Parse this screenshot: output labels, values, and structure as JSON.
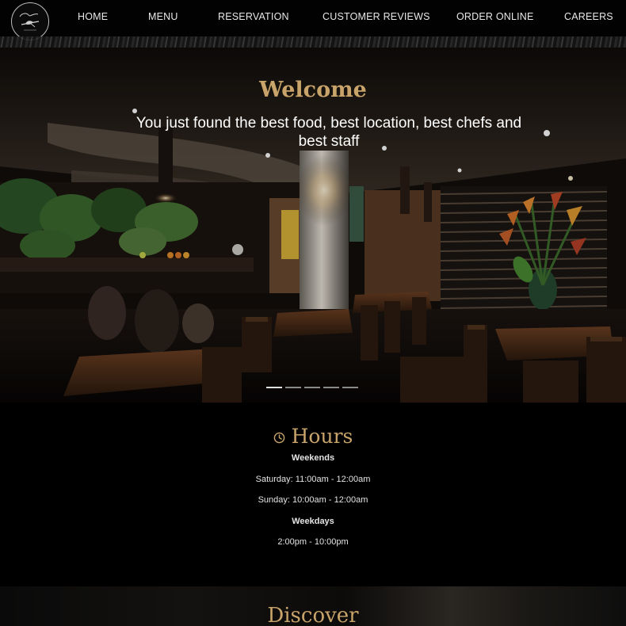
{
  "nav": {
    "logo_icon": "cursive-script-logo-icon",
    "items": [
      "HOME",
      "MENU",
      "RESERVATION",
      "CUSTOMER REVIEWS",
      "ORDER ONLINE",
      "CAREERS"
    ]
  },
  "hero": {
    "title": "Welcome",
    "subtitle": "You just found the best food, best location, best chefs and best staff",
    "slide_count": 5,
    "active_slide": 1
  },
  "hours": {
    "icon": "clock-icon",
    "title": "Hours",
    "rows": [
      {
        "text": "Weekends",
        "bold": true
      },
      {
        "text": "Saturday: 11:00am - 12:00am",
        "bold": false
      },
      {
        "text": "Sunday: 10:00am - 12:00am",
        "bold": false
      },
      {
        "text": "Weekdays",
        "bold": true
      },
      {
        "text": "2:00pm - 10:00pm",
        "bold": false
      }
    ]
  },
  "discover": {
    "title": "Discover"
  },
  "colors": {
    "accent_gold": "#c8a36a",
    "background": "#000000",
    "nav_text": "#e8e8e8"
  }
}
